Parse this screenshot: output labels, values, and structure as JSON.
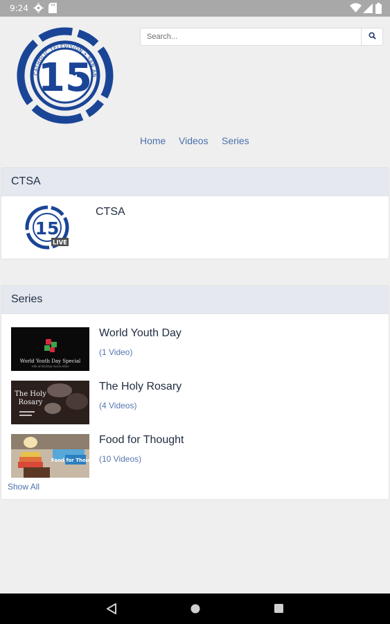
{
  "status_bar": {
    "time": "9:24",
    "left_icons": [
      "gear-icon",
      "sd-card-icon"
    ],
    "right_icons": [
      "wifi-icon",
      "signal-icon",
      "battery-icon"
    ]
  },
  "header": {
    "logo": {
      "number": "15",
      "ring_text": "CATHOLIC TELEVISION • SAN ANTONIO",
      "brand_color": "#1a4597"
    },
    "search": {
      "placeholder": "Search...",
      "icon": "search-icon"
    },
    "nav": [
      {
        "label": "Home"
      },
      {
        "label": "Videos"
      },
      {
        "label": "Series"
      }
    ]
  },
  "ctsa_panel": {
    "heading": "CTSA",
    "item": {
      "title": "CTSA",
      "thumb_number": "15",
      "thumb_badge": "LIVE"
    }
  },
  "series_panel": {
    "heading": "Series",
    "items": [
      {
        "title": "World Youth Day",
        "count": "(1 Video)",
        "thumb_caption": "World Youth Day Special",
        "thumb_subcaption": "with Archbishop Garcia-Siller"
      },
      {
        "title": "The Holy Rosary",
        "count": "(4 Videos)",
        "thumb_caption": "The Holy Rosary"
      },
      {
        "title": "Food for Thought",
        "count": "(10 Videos)",
        "thumb_caption": "Food for Thought"
      }
    ],
    "show_all": "Show All"
  },
  "system_nav": {
    "buttons": [
      "back-icon",
      "home-icon",
      "recents-icon"
    ]
  }
}
